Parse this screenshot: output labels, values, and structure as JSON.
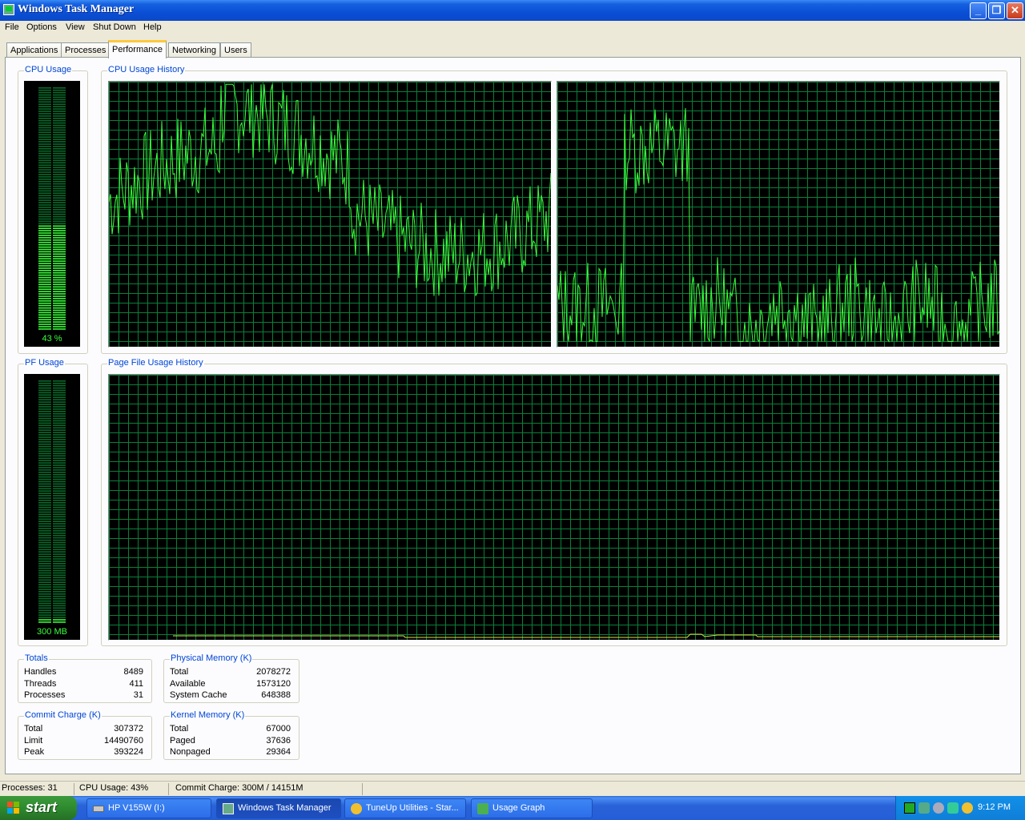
{
  "window": {
    "title": "Windows Task Manager"
  },
  "menu": [
    "File",
    "Options",
    "View",
    "Shut Down",
    "Help"
  ],
  "tabs": [
    "Applications",
    "Processes",
    "Performance",
    "Networking",
    "Users"
  ],
  "active_tab": "Performance",
  "groups": {
    "cpu_usage": "CPU Usage",
    "cpu_history": "CPU Usage History",
    "pf_usage": "PF Usage",
    "pf_history": "Page File Usage History"
  },
  "cpu_meter": {
    "value_text": "43 %",
    "level": 0.43
  },
  "pf_meter": {
    "value_text": "300 MB",
    "level": 0.02
  },
  "totals": {
    "label": "Totals",
    "rows": [
      {
        "k": "Handles",
        "v": "8489"
      },
      {
        "k": "Threads",
        "v": "411"
      },
      {
        "k": "Processes",
        "v": "31"
      }
    ]
  },
  "physical_memory": {
    "label": "Physical Memory (K)",
    "rows": [
      {
        "k": "Total",
        "v": "2078272"
      },
      {
        "k": "Available",
        "v": "1573120"
      },
      {
        "k": "System Cache",
        "v": "648388"
      }
    ]
  },
  "commit_charge": {
    "label": "Commit Charge (K)",
    "rows": [
      {
        "k": "Total",
        "v": "307372"
      },
      {
        "k": "Limit",
        "v": "14490760"
      },
      {
        "k": "Peak",
        "v": "393224"
      }
    ]
  },
  "kernel_memory": {
    "label": "Kernel Memory (K)",
    "rows": [
      {
        "k": "Total",
        "v": "67000"
      },
      {
        "k": "Paged",
        "v": "37636"
      },
      {
        "k": "Nonpaged",
        "v": "29364"
      }
    ]
  },
  "status": {
    "processes": "Processes: 31",
    "cpu": "CPU Usage: 43%",
    "commit": "Commit Charge: 300M / 14151M"
  },
  "taskbar": {
    "start": "start",
    "items": [
      {
        "label": "HP V155W (I:)",
        "icon": "drive-icon"
      },
      {
        "label": "Windows Task Manager",
        "icon": "task-manager-icon",
        "active": true
      },
      {
        "label": "TuneUp Utilities - Star...",
        "icon": "tuneup-icon"
      },
      {
        "label": "Usage Graph",
        "icon": "usage-graph-icon"
      }
    ],
    "clock": "9:12 PM"
  },
  "colors": {
    "graph_line": "#3bff3b",
    "grid": "#0a7f3a",
    "pf_line": "#e0e040",
    "group_label": "#0046d5"
  }
}
